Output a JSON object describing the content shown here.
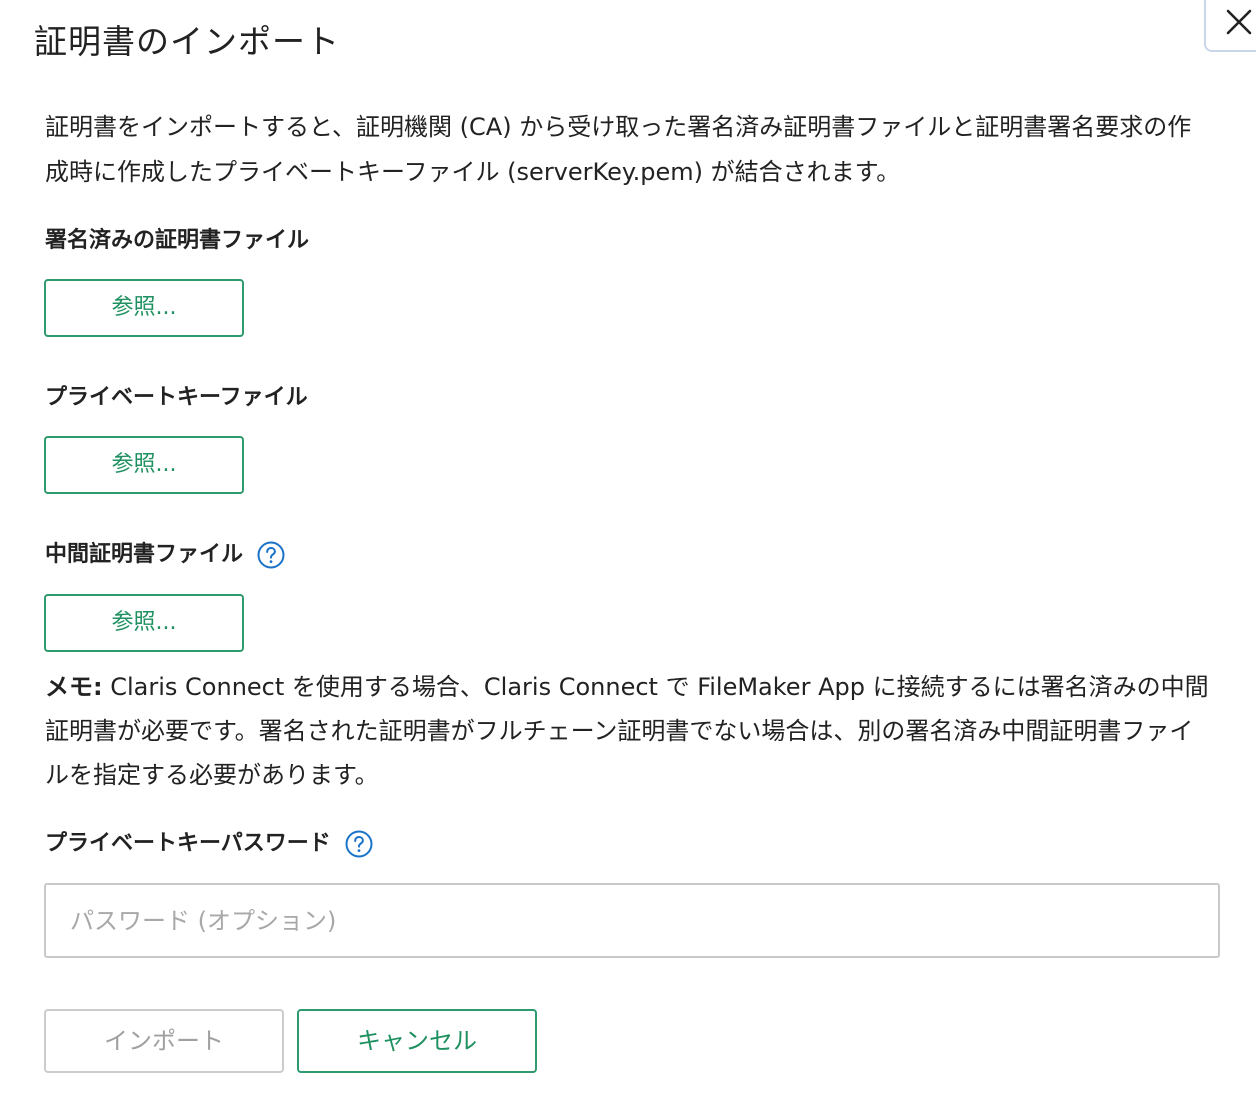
{
  "dialog": {
    "title": "証明書のインポート",
    "close_icon": "close-icon",
    "description": "証明書をインポートすると、証明機関 (CA) から受け取った署名済み証明書ファイルと証明書署名要求の作成時に作成したプライベートキーファイル (serverKey.pem) が結合されます。"
  },
  "sections": {
    "signed_cert": {
      "label": "署名済みの証明書ファイル",
      "button": "参照..."
    },
    "private_key": {
      "label": "プライベートキーファイル",
      "button": "参照..."
    },
    "intermediate_cert": {
      "label": "中間証明書ファイル",
      "button": "参照...",
      "help_icon": "question-circle-icon"
    }
  },
  "memo": {
    "prefix": "メモ:",
    "text": " Claris Connect を使用する場合、Claris Connect で FileMaker App に接続するには署名済みの中間証明書が必要です。署名された証明書がフルチェーン証明書でない場合は、別の署名済み中間証明書ファイルを指定する必要があります。"
  },
  "password": {
    "label": "プライベートキーパスワード",
    "placeholder": "パスワード (オプション)",
    "value": "",
    "help_icon": "question-circle-icon"
  },
  "footer": {
    "import_label": "インポート",
    "cancel_label": "キャンセル"
  },
  "colors": {
    "accent_green": "#1f9160",
    "help_blue": "#1a73c8",
    "disabled_gray": "#a0a0a0"
  }
}
